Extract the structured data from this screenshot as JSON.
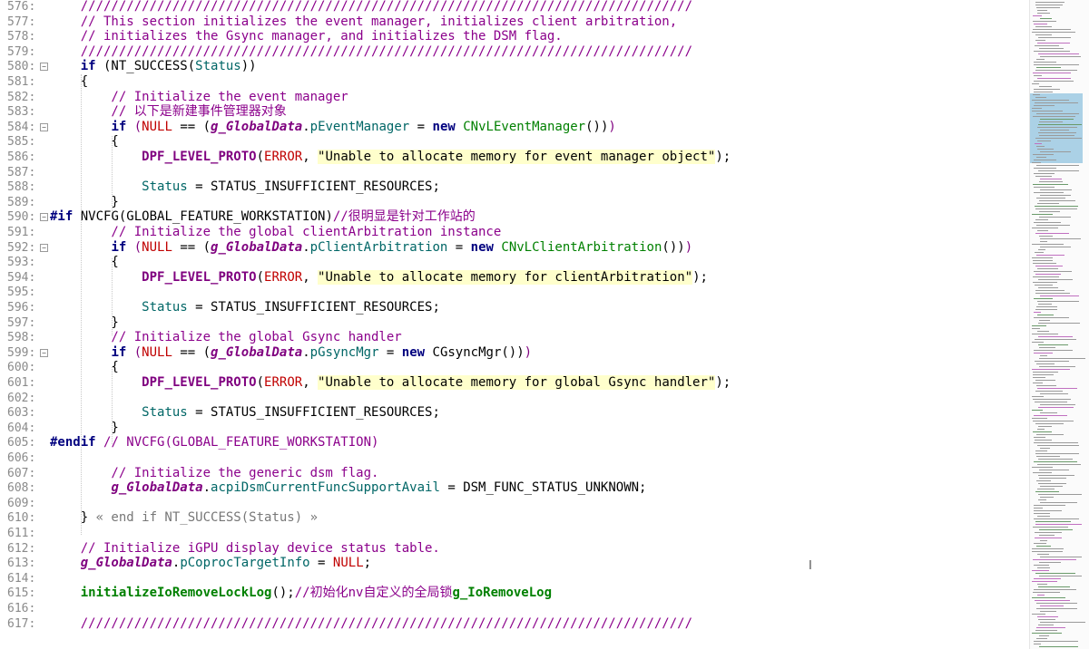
{
  "editor": {
    "lines": [
      {
        "n": "576:",
        "fold": false,
        "tokens": [
          {
            "c": "cm",
            "t": "    ////////////////////////////////////////////////////////////////////////////////"
          }
        ]
      },
      {
        "n": "577:",
        "fold": false,
        "tokens": [
          {
            "c": "cm",
            "t": "    // This section initializes the event manager, initializes client arbitration,"
          }
        ]
      },
      {
        "n": "578:",
        "fold": false,
        "tokens": [
          {
            "c": "cm",
            "t": "    // initializes the Gsync manager, and initializes the DSM flag."
          }
        ]
      },
      {
        "n": "579:",
        "fold": false,
        "tokens": [
          {
            "c": "cm",
            "t": "    ////////////////////////////////////////////////////////////////////////////////"
          }
        ]
      },
      {
        "n": "580:",
        "fold": true,
        "tokens": [
          {
            "c": "",
            "t": "    "
          },
          {
            "c": "kw",
            "t": "if"
          },
          {
            "c": "",
            "t": " (NT_SUCCESS("
          },
          {
            "c": "id",
            "t": "Status"
          },
          {
            "c": "",
            "t": "))"
          }
        ]
      },
      {
        "n": "581:",
        "fold": false,
        "tokens": [
          {
            "c": "",
            "t": "    {"
          }
        ]
      },
      {
        "n": "582:",
        "fold": false,
        "tokens": [
          {
            "c": "cm",
            "t": "        // Initialize the event manager"
          }
        ]
      },
      {
        "n": "583:",
        "fold": false,
        "tokens": [
          {
            "c": "cm",
            "t": "        // 以下是新建事件管理器对象"
          }
        ]
      },
      {
        "n": "584:",
        "fold": true,
        "tokens": [
          {
            "c": "",
            "t": "        "
          },
          {
            "c": "kw",
            "t": "if"
          },
          {
            "c": "",
            "t": " "
          },
          {
            "c": "par",
            "t": "("
          },
          {
            "c": "er",
            "t": "NULL"
          },
          {
            "c": "",
            "t": " == ("
          },
          {
            "c": "gl",
            "t": "g_GlobalData"
          },
          {
            "c": "",
            "t": "."
          },
          {
            "c": "id",
            "t": "pEventManager"
          },
          {
            "c": "",
            "t": " = "
          },
          {
            "c": "kw",
            "t": "new"
          },
          {
            "c": "",
            "t": " "
          },
          {
            "c": "fn",
            "t": "CNvLEventManager"
          },
          {
            "c": "",
            "t": "())"
          },
          {
            "c": "par",
            "t": ")"
          }
        ]
      },
      {
        "n": "585:",
        "fold": false,
        "tokens": [
          {
            "c": "",
            "t": "        {"
          }
        ]
      },
      {
        "n": "586:",
        "fold": false,
        "tokens": [
          {
            "c": "",
            "t": "            "
          },
          {
            "c": "mac",
            "t": "DPF_LEVEL_PROTO"
          },
          {
            "c": "",
            "t": "("
          },
          {
            "c": "er",
            "t": "ERROR"
          },
          {
            "c": "",
            "t": ", "
          },
          {
            "c": "st",
            "t": "\"Unable to allocate memory for event manager object\""
          },
          {
            "c": "",
            "t": ");"
          }
        ]
      },
      {
        "n": "587:",
        "fold": false,
        "tokens": []
      },
      {
        "n": "588:",
        "fold": false,
        "tokens": [
          {
            "c": "",
            "t": "            "
          },
          {
            "c": "id",
            "t": "Status"
          },
          {
            "c": "",
            "t": " = STATUS_INSUFFICIENT_RESOURCES;"
          }
        ]
      },
      {
        "n": "589:",
        "fold": false,
        "tokens": [
          {
            "c": "",
            "t": "        }"
          }
        ]
      },
      {
        "n": "590:",
        "fold": true,
        "tokens": [
          {
            "c": "kw",
            "t": "#if"
          },
          {
            "c": "",
            "t": " NVCFG(GLOBAL_FEATURE_WORKSTATION)"
          },
          {
            "c": "cm",
            "t": "//很明显是针对工作站的"
          }
        ]
      },
      {
        "n": "591:",
        "fold": false,
        "tokens": [
          {
            "c": "cm",
            "t": "        // Initialize the global clientArbitration instance"
          }
        ]
      },
      {
        "n": "592:",
        "fold": true,
        "tokens": [
          {
            "c": "",
            "t": "        "
          },
          {
            "c": "kw",
            "t": "if"
          },
          {
            "c": "",
            "t": " "
          },
          {
            "c": "par",
            "t": "("
          },
          {
            "c": "er",
            "t": "NULL"
          },
          {
            "c": "",
            "t": " == ("
          },
          {
            "c": "gl",
            "t": "g_GlobalData"
          },
          {
            "c": "",
            "t": "."
          },
          {
            "c": "id",
            "t": "pClientArbitration"
          },
          {
            "c": "",
            "t": " = "
          },
          {
            "c": "kw",
            "t": "new"
          },
          {
            "c": "",
            "t": " "
          },
          {
            "c": "fn",
            "t": "CNvLClientArbitration"
          },
          {
            "c": "",
            "t": "())"
          },
          {
            "c": "par",
            "t": ")"
          }
        ]
      },
      {
        "n": "593:",
        "fold": false,
        "tokens": [
          {
            "c": "",
            "t": "        {"
          }
        ]
      },
      {
        "n": "594:",
        "fold": false,
        "tokens": [
          {
            "c": "",
            "t": "            "
          },
          {
            "c": "mac",
            "t": "DPF_LEVEL_PROTO"
          },
          {
            "c": "",
            "t": "("
          },
          {
            "c": "er",
            "t": "ERROR"
          },
          {
            "c": "",
            "t": ", "
          },
          {
            "c": "st",
            "t": "\"Unable to allocate memory for clientArbitration\""
          },
          {
            "c": "",
            "t": ");"
          }
        ]
      },
      {
        "n": "595:",
        "fold": false,
        "tokens": []
      },
      {
        "n": "596:",
        "fold": false,
        "tokens": [
          {
            "c": "",
            "t": "            "
          },
          {
            "c": "id",
            "t": "Status"
          },
          {
            "c": "",
            "t": " = STATUS_INSUFFICIENT_RESOURCES;"
          }
        ]
      },
      {
        "n": "597:",
        "fold": false,
        "tokens": [
          {
            "c": "",
            "t": "        }"
          }
        ]
      },
      {
        "n": "598:",
        "fold": false,
        "tokens": [
          {
            "c": "cm",
            "t": "        // Initialize the global Gsync handler"
          }
        ]
      },
      {
        "n": "599:",
        "fold": true,
        "tokens": [
          {
            "c": "",
            "t": "        "
          },
          {
            "c": "kw",
            "t": "if"
          },
          {
            "c": "",
            "t": " "
          },
          {
            "c": "par",
            "t": "("
          },
          {
            "c": "er",
            "t": "NULL"
          },
          {
            "c": "",
            "t": " == ("
          },
          {
            "c": "gl",
            "t": "g_GlobalData"
          },
          {
            "c": "",
            "t": "."
          },
          {
            "c": "id",
            "t": "pGsyncMgr"
          },
          {
            "c": "",
            "t": " = "
          },
          {
            "c": "kw",
            "t": "new"
          },
          {
            "c": "",
            "t": " CGsyncMgr())"
          },
          {
            "c": "par",
            "t": ")"
          }
        ]
      },
      {
        "n": "600:",
        "fold": false,
        "tokens": [
          {
            "c": "",
            "t": "        {"
          }
        ]
      },
      {
        "n": "601:",
        "fold": false,
        "tokens": [
          {
            "c": "",
            "t": "            "
          },
          {
            "c": "mac",
            "t": "DPF_LEVEL_PROTO"
          },
          {
            "c": "",
            "t": "("
          },
          {
            "c": "er",
            "t": "ERROR"
          },
          {
            "c": "",
            "t": ", "
          },
          {
            "c": "st",
            "t": "\"Unable to allocate memory for global Gsync handler\""
          },
          {
            "c": "",
            "t": ");"
          }
        ]
      },
      {
        "n": "602:",
        "fold": false,
        "tokens": []
      },
      {
        "n": "603:",
        "fold": false,
        "tokens": [
          {
            "c": "",
            "t": "            "
          },
          {
            "c": "id",
            "t": "Status"
          },
          {
            "c": "",
            "t": " = STATUS_INSUFFICIENT_RESOURCES;"
          }
        ]
      },
      {
        "n": "604:",
        "fold": false,
        "tokens": [
          {
            "c": "",
            "t": "        }"
          }
        ]
      },
      {
        "n": "605:",
        "fold": false,
        "tokens": [
          {
            "c": "kw",
            "t": "#endif"
          },
          {
            "c": "",
            "t": " "
          },
          {
            "c": "cm",
            "t": "// NVCFG(GLOBAL_FEATURE_WORKSTATION)"
          }
        ]
      },
      {
        "n": "606:",
        "fold": false,
        "tokens": []
      },
      {
        "n": "607:",
        "fold": false,
        "tokens": [
          {
            "c": "cm",
            "t": "        // Initialize the generic dsm flag."
          }
        ]
      },
      {
        "n": "608:",
        "fold": false,
        "tokens": [
          {
            "c": "",
            "t": "        "
          },
          {
            "c": "gl",
            "t": "g_GlobalData"
          },
          {
            "c": "",
            "t": "."
          },
          {
            "c": "id",
            "t": "acpiDsmCurrentFuncSupportAvail"
          },
          {
            "c": "",
            "t": " = DSM_FUNC_STATUS_UNKNOWN;"
          }
        ]
      },
      {
        "n": "609:",
        "fold": false,
        "tokens": []
      },
      {
        "n": "610:",
        "fold": false,
        "tokens": [
          {
            "c": "",
            "t": "    } "
          },
          {
            "c": "fold",
            "t": "« end if NT_SUCCESS(Status) »"
          }
        ]
      },
      {
        "n": "611:",
        "fold": false,
        "tokens": []
      },
      {
        "n": "612:",
        "fold": false,
        "tokens": [
          {
            "c": "cm",
            "t": "    // Initialize iGPU display device status table."
          }
        ]
      },
      {
        "n": "613:",
        "fold": false,
        "tokens": [
          {
            "c": "",
            "t": "    "
          },
          {
            "c": "gl",
            "t": "g_GlobalData"
          },
          {
            "c": "",
            "t": "."
          },
          {
            "c": "id",
            "t": "pCoprocTargetInfo"
          },
          {
            "c": "",
            "t": " = "
          },
          {
            "c": "er",
            "t": "NULL"
          },
          {
            "c": "",
            "t": ";"
          }
        ]
      },
      {
        "n": "614:",
        "fold": false,
        "tokens": []
      },
      {
        "n": "615:",
        "fold": false,
        "tokens": [
          {
            "c": "",
            "t": "    "
          },
          {
            "c": "kwg",
            "t": "initializeIoRemoveLockLog"
          },
          {
            "c": "",
            "t": "();"
          },
          {
            "c": "cm",
            "t": "//初始化nv自定义的全局锁"
          },
          {
            "c": "kwg",
            "t": "g_IoRemoveLog"
          }
        ]
      },
      {
        "n": "616:",
        "fold": false,
        "tokens": []
      },
      {
        "n": "617:",
        "fold": false,
        "tokens": [
          {
            "c": "cm",
            "t": "    ////////////////////////////////////////////////////////////////////////////////"
          }
        ]
      }
    ]
  },
  "caret_icon": "I",
  "colors": {
    "comment": "#8b008b",
    "keyword": "#00007f",
    "string_bg": "#ffffcc",
    "error": "#c00000",
    "identifier": "#006666",
    "minimap_viewport": "#6aaed6"
  }
}
